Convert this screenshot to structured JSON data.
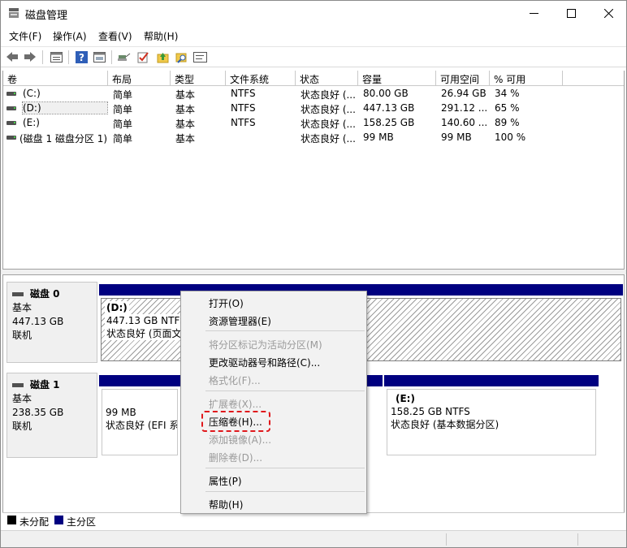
{
  "window": {
    "title": "磁盘管理"
  },
  "menu": [
    "文件(F)",
    "操作(A)",
    "查看(V)",
    "帮助(H)"
  ],
  "toolbar_icons": [
    "back-arrow-icon",
    "forward-arrow-icon",
    "list-view-icon",
    "help-icon",
    "properties-icon",
    "connect-icon",
    "check-icon",
    "folder-up-icon",
    "search-icon",
    "settings-icon"
  ],
  "table": {
    "columns": [
      "卷",
      "布局",
      "类型",
      "文件系统",
      "状态",
      "容量",
      "可用空间",
      "% 可用"
    ],
    "rows": [
      [
        "(C:)",
        "简单",
        "基本",
        "NTFS",
        "状态良好 (...",
        "80.00 GB",
        "26.94 GB",
        "34 %"
      ],
      [
        "(D:)",
        "简单",
        "基本",
        "NTFS",
        "状态良好 (...",
        "447.13 GB",
        "291.12 ...",
        "65 %"
      ],
      [
        "(E:)",
        "简单",
        "基本",
        "NTFS",
        "状态良好 (...",
        "158.25 GB",
        "140.60 ...",
        "89 %"
      ],
      [
        "(磁盘 1 磁盘分区 1)",
        "简单",
        "基本",
        "",
        "状态良好 (...",
        "99 MB",
        "99 MB",
        "100 %"
      ]
    ]
  },
  "disks": [
    {
      "name": "磁盘 0",
      "type": "基本",
      "size": "447.13 GB",
      "status": "联机",
      "partitions": [
        {
          "label": "(D:)",
          "size": "447.13 GB NTFS",
          "status": "状态良好 (页面文"
        }
      ]
    },
    {
      "name": "磁盘 1",
      "type": "基本",
      "size": "238.35 GB",
      "status": "联机",
      "partitions": [
        {
          "label": "",
          "size": "99 MB",
          "status": "状态良好 (EFI 系"
        },
        {
          "label": "(E:)",
          "size": "158.25 GB NTFS",
          "status": "状态良好 (基本数据分区)"
        }
      ]
    }
  ],
  "legend": {
    "unallocated": "未分配",
    "primary": "主分区",
    "unallocated_color": "#000000",
    "primary_color": "#000080"
  },
  "context_menu": {
    "items": [
      {
        "label": "打开(O)",
        "enabled": true
      },
      {
        "label": "资源管理器(E)",
        "enabled": true
      },
      {
        "label": "将分区标记为活动分区(M)",
        "enabled": false
      },
      {
        "label": "更改驱动器号和路径(C)...",
        "enabled": true
      },
      {
        "label": "格式化(F)...",
        "enabled": false
      },
      {
        "label": "扩展卷(X)...",
        "enabled": false
      },
      {
        "label": "压缩卷(H)...",
        "enabled": true,
        "highlighted": true
      },
      {
        "label": "添加镜像(A)...",
        "enabled": false
      },
      {
        "label": "删除卷(D)...",
        "enabled": false
      },
      {
        "label": "属性(P)",
        "enabled": true
      },
      {
        "label": "帮助(H)",
        "enabled": true
      }
    ]
  },
  "colors": {
    "primary_partition": "#000080",
    "highlight": "#e0181c"
  }
}
